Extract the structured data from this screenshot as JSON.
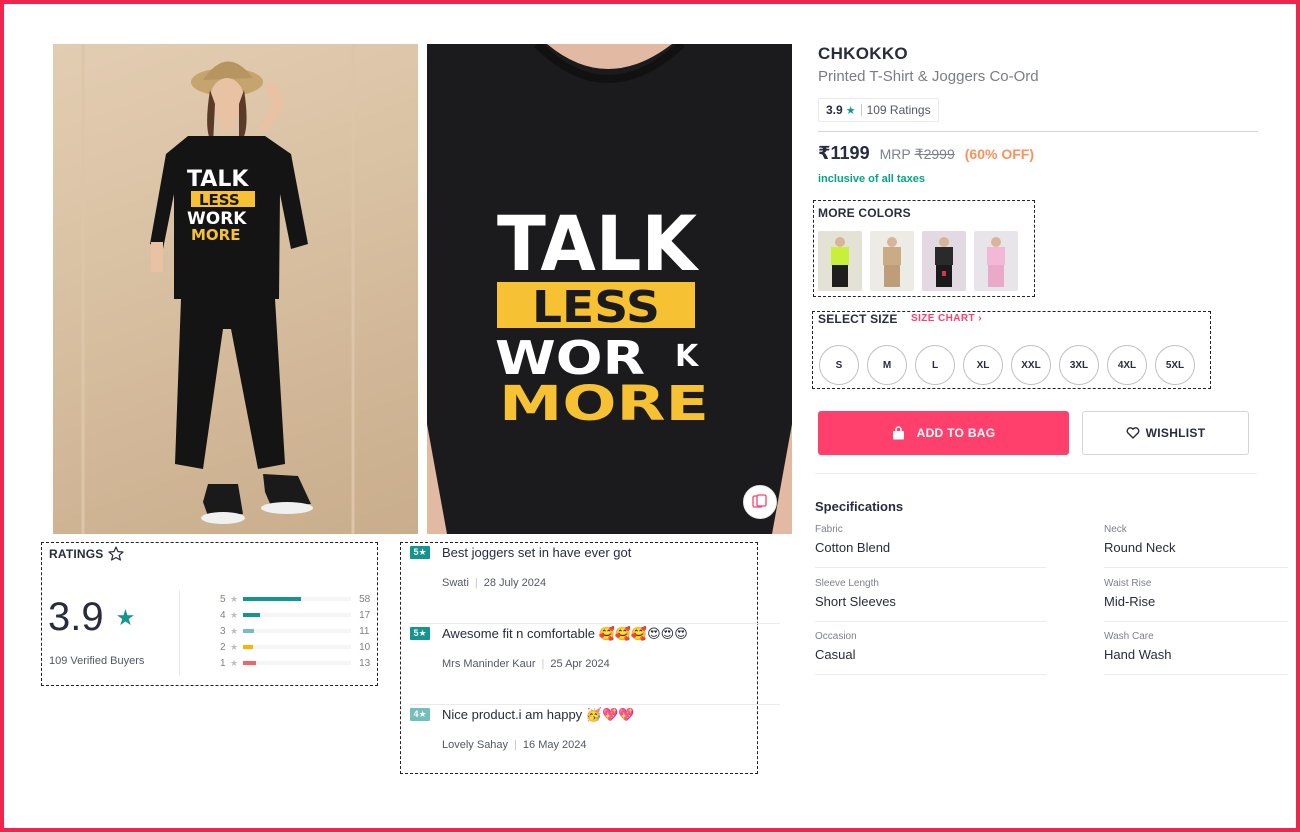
{
  "product": {
    "brand": "CHKOKKO",
    "name": "Printed T-Shirt & Joggers Co-Ord",
    "rating": "3.9",
    "ratings_count": "109 Ratings",
    "price": "₹1199",
    "mrp_label": "MRP",
    "mrp_value": "₹2999",
    "discount": "(60% OFF)",
    "tax_note": "inclusive of all taxes"
  },
  "colors": {
    "title": "MORE COLORS",
    "swatches": [
      {
        "name": "neon-green",
        "top": "#c8ef3a",
        "bottom": "#1e1e1e",
        "bg": "#e4e1d5"
      },
      {
        "name": "beige",
        "top": "#c9ab86",
        "bottom": "#bd9e79",
        "bg": "#ecebe5"
      },
      {
        "name": "black",
        "top": "#2a2a2a",
        "bottom": "#1a1a1a",
        "bg": "#e2d9e2"
      },
      {
        "name": "pink",
        "top": "#f2b8d6",
        "bottom": "#e9a9c9",
        "bg": "#e8e5ea"
      }
    ]
  },
  "sizes": {
    "title": "SELECT SIZE",
    "chart_label": "SIZE CHART",
    "options": [
      "S",
      "M",
      "L",
      "XL",
      "XXL",
      "3XL",
      "4XL",
      "5XL"
    ]
  },
  "actions": {
    "add_to_bag": "ADD TO BAG",
    "wishlist": "WISHLIST"
  },
  "specifications": {
    "title": "Specifications",
    "items": [
      {
        "label": "Fabric",
        "value": "Cotton Blend"
      },
      {
        "label": "Neck",
        "value": "Round Neck"
      },
      {
        "label": "Sleeve Length",
        "value": "Short Sleeves"
      },
      {
        "label": "Waist Rise",
        "value": "Mid-Rise"
      },
      {
        "label": "Occasion",
        "value": "Casual"
      },
      {
        "label": "Wash Care",
        "value": "Hand Wash"
      }
    ]
  },
  "ratings": {
    "title": "RATINGS",
    "average": "3.9",
    "verified": "109 Verified Buyers",
    "distribution": [
      {
        "stars": "5",
        "count": "58",
        "fraction": 0.532,
        "color": "#14958f"
      },
      {
        "stars": "4",
        "count": "17",
        "fraction": 0.156,
        "color": "#14958f"
      },
      {
        "stars": "3",
        "count": "11",
        "fraction": 0.101,
        "color": "#72bfbc"
      },
      {
        "stars": "2",
        "count": "10",
        "fraction": 0.092,
        "color": "#fcb301"
      },
      {
        "stars": "1",
        "count": "13",
        "fraction": 0.119,
        "color": "#f16565"
      }
    ]
  },
  "reviews": [
    {
      "badge": "5★",
      "badge_color": "#14958f",
      "text": "Best joggers set in have ever got",
      "author": "Swati",
      "date": "28 July 2024"
    },
    {
      "badge": "5★",
      "badge_color": "#14958f",
      "text": "Awesome fit n comfortable 🥰🥰🥰😍😍😍",
      "author": "Mrs Maninder Kaur",
      "date": "25 Apr 2024"
    },
    {
      "badge": "4★",
      "badge_color": "#72bfbc",
      "text": "Nice product.i am happy 🥳💖💖",
      "author": "Lovely Sahay",
      "date": "16 May 2024"
    }
  ],
  "images": {
    "print_lines": [
      "TALK",
      "LESS",
      "WOR",
      "K",
      "MORE"
    ]
  },
  "theme": {
    "accent": "#ff3f6c",
    "frame": "#f0254f",
    "teal": "#14958f",
    "discount": "#ff905a",
    "print_yellow": "#f6c233"
  }
}
